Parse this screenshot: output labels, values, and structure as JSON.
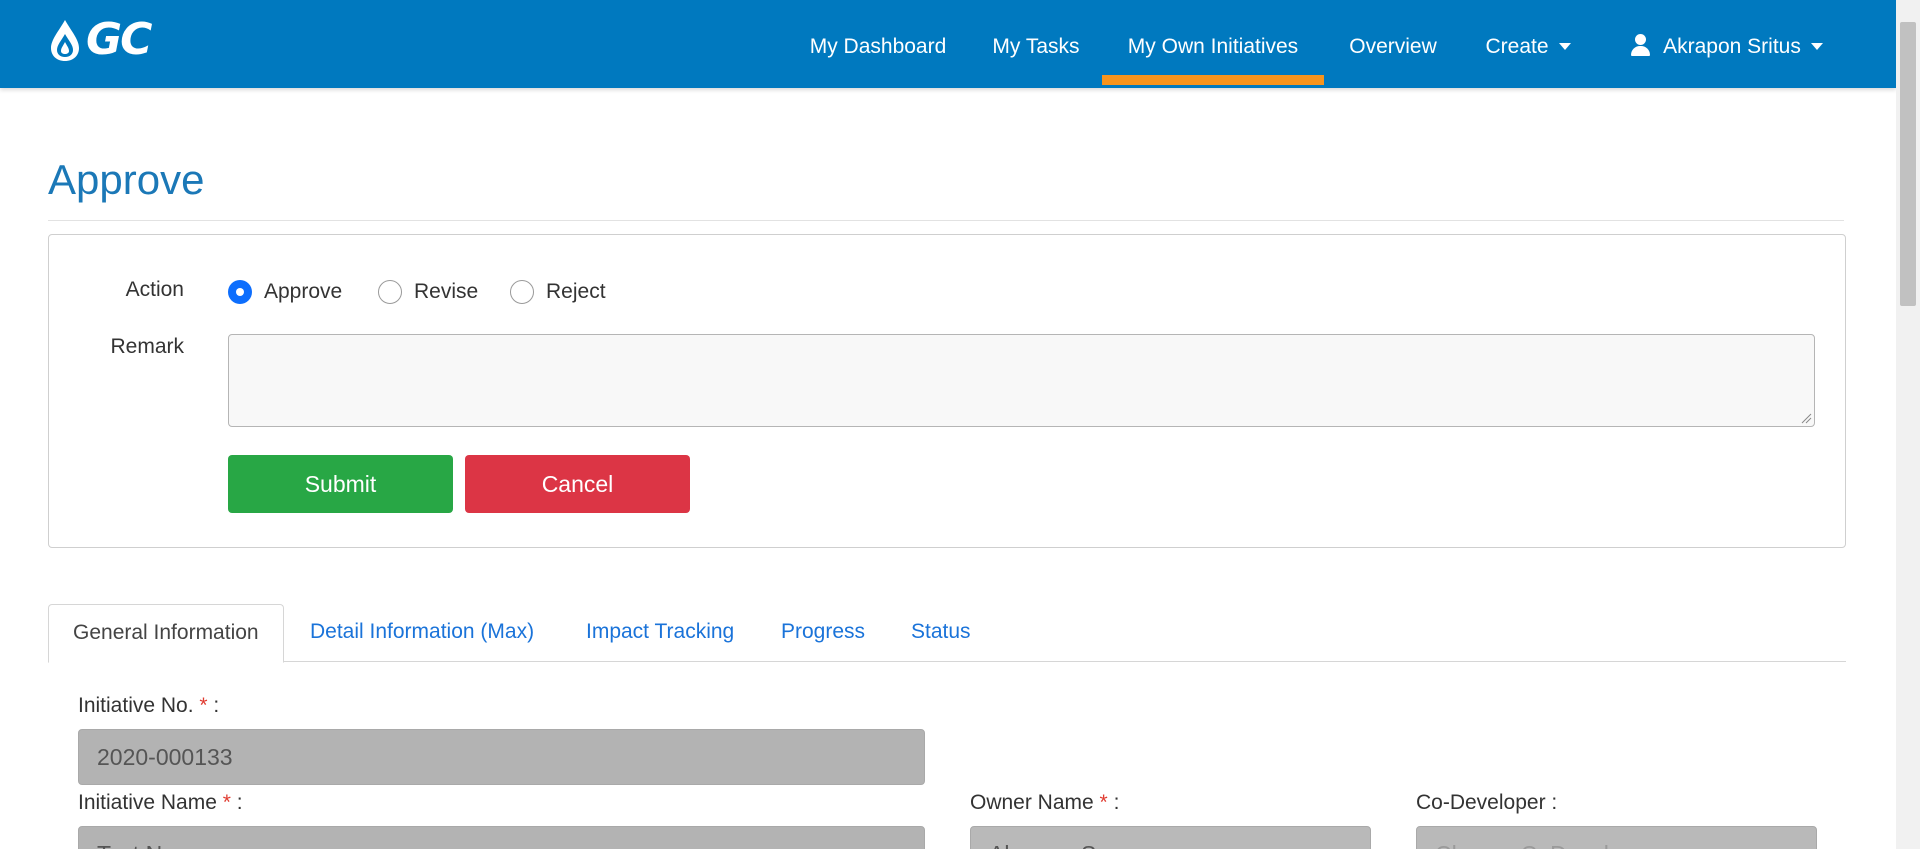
{
  "header": {
    "logo_text": "GC",
    "brand_color": "#0079bf",
    "active_indicator_color": "#f7941d",
    "nav": [
      {
        "label": "My Dashboard"
      },
      {
        "label": "My Tasks"
      },
      {
        "label": "My Own Initiatives",
        "active": true
      },
      {
        "label": "Overview"
      },
      {
        "label": "Create",
        "dropdown": true
      }
    ],
    "user": {
      "name": "Akrapon Sritus",
      "icon": "user-icon"
    }
  },
  "page": {
    "title": "Approve"
  },
  "approval": {
    "action_label": "Action",
    "options": [
      {
        "label": "Approve",
        "checked": true
      },
      {
        "label": "Revise",
        "checked": false
      },
      {
        "label": "Reject",
        "checked": false
      }
    ],
    "remark_label": "Remark",
    "remark_value": "",
    "submit_label": "Submit",
    "cancel_label": "Cancel",
    "submit_color": "#28a745",
    "cancel_color": "#dc3545"
  },
  "tabs": [
    {
      "label": "General Information",
      "active": true
    },
    {
      "label": "Detail Information (Max)"
    },
    {
      "label": "Impact Tracking"
    },
    {
      "label": "Progress"
    },
    {
      "label": "Status"
    }
  ],
  "form": {
    "initiative_no": {
      "label": "Initiative No.",
      "required": true,
      "value": "2020-000133"
    },
    "initiative_name": {
      "label": "Initiative Name",
      "required": true,
      "value": "Test Name"
    },
    "owner_name": {
      "label": "Owner Name",
      "required": true,
      "value": "Akrapon S."
    },
    "co_developer": {
      "label": "Co-Developer :",
      "required": false,
      "placeholder": "Choose CoDevelopers"
    }
  }
}
